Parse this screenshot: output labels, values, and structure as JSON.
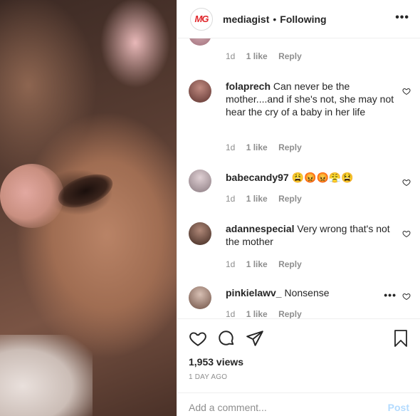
{
  "header": {
    "logo_text": "MG",
    "username": "mediagist",
    "separator": "•",
    "follow_status": "Following",
    "more_label": "•••"
  },
  "comments": [
    {
      "username": "",
      "text": "",
      "time": "1d",
      "likes": "1 like",
      "reply": "Reply",
      "avatar_color": "#c9a0a8"
    },
    {
      "username": "folaprech",
      "text": "Can never be the mother....and if she's not, she may not hear the cry of a baby in her life",
      "time": "1d",
      "likes": "1 like",
      "reply": "Reply",
      "avatar_color": "#7a4a45"
    },
    {
      "username": "babecandy97",
      "text": "😩😡😡😤😫",
      "time": "1d",
      "likes": "1 like",
      "reply": "Reply",
      "avatar_color": "#b8a8ae"
    },
    {
      "username": "adannespecial",
      "text": "Very wrong that's not the mother",
      "time": "1d",
      "likes": "1 like",
      "reply": "Reply",
      "avatar_color": "#6a4a3c"
    },
    {
      "username": "pinkielawv_",
      "text": "Nonsense",
      "time": "1d",
      "likes": "1 like",
      "reply": "Reply",
      "avatar_color": "#9a7a6a",
      "more_label": "•••"
    }
  ],
  "post": {
    "views": "1,953 views",
    "time_ago": "1 DAY AGO"
  },
  "composer": {
    "placeholder": "Add a comment...",
    "post_label": "Post"
  },
  "colors": {
    "brand_red": "#e0262b",
    "muted": "#8e8e8e",
    "post_disabled": "#b3dbff"
  }
}
